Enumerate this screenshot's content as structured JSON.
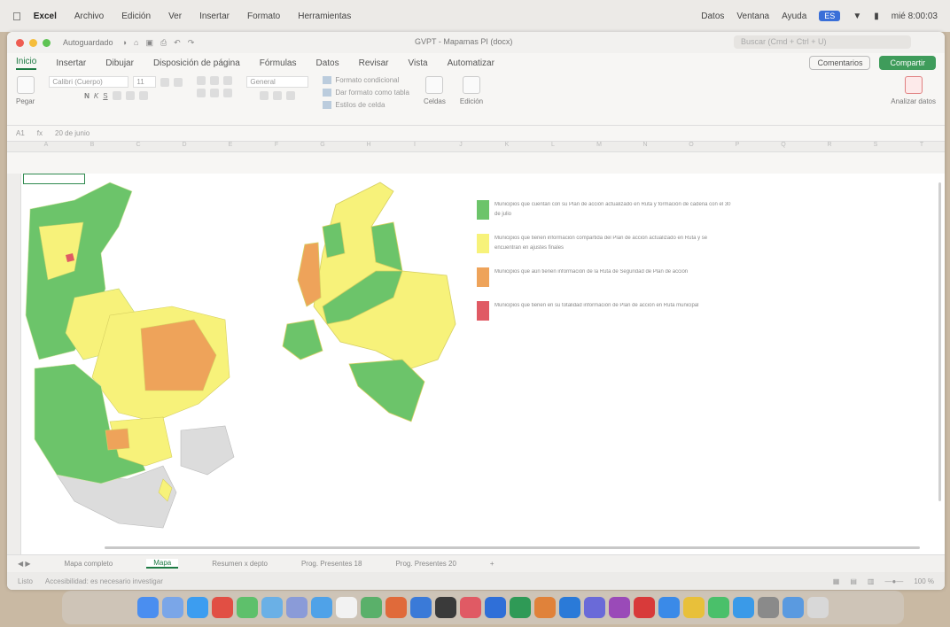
{
  "menubar": {
    "app": "Excel",
    "items": [
      "Archivo",
      "Edición",
      "Ver",
      "Insertar",
      "Formato",
      "Herramientas"
    ],
    "right_items": [
      "Datos",
      "Ventana",
      "Ayuda"
    ],
    "clock": "mié 8:00:03"
  },
  "window": {
    "autosave": "Autoguardado",
    "title": "GVPT - Mapamas PI (docx)",
    "search_placeholder": "Buscar (Cmd + Ctrl + U)"
  },
  "ribbon_tabs": {
    "tabs": [
      "Inicio",
      "Insertar",
      "Dibujar",
      "Disposición de página",
      "Fórmulas",
      "Datos",
      "Revisar",
      "Vista",
      "Automatizar"
    ],
    "comments": "Comentarios",
    "share": "Compartir"
  },
  "ribbon": {
    "paste": "Pegar",
    "font": "Calibri (Cuerpo)",
    "size": "11",
    "number_format": "General",
    "conditional": "Formato condicional",
    "as_table": "Dar formato como tabla",
    "cell_styles": "Estilos de celda",
    "cells": "Celdas",
    "editing": "Edición",
    "analyze": "Analizar datos"
  },
  "formula_bar": {
    "cell_ref": "A1",
    "fx": "fx",
    "content": "20 de junio"
  },
  "column_letters": [
    "A",
    "B",
    "C",
    "D",
    "E",
    "F",
    "G",
    "H",
    "I",
    "J",
    "K",
    "L",
    "M",
    "N",
    "O",
    "P",
    "Q",
    "R",
    "S",
    "T"
  ],
  "legend": {
    "items": [
      {
        "color": "#6cc46a",
        "text": "Municipios que cuentan con su Plan de acción actualizado en Ruta y formación de cadena con el 30 de julio"
      },
      {
        "color": "#f7f27a",
        "text": "Municipios que tienen información compartida del Plan de acción actualizado en Ruta y se encuentran en ajustes finales"
      },
      {
        "color": "#eea35a",
        "text": "Municipios que aún tienen información de la Ruta de Seguridad de Plan de acción"
      },
      {
        "color": "#e05a64",
        "text": "Municipios que tienen en su totalidad información de Plan de acción en Ruta municipal"
      }
    ]
  },
  "sheet_tabs": {
    "tabs": [
      "Mapa completo",
      "Mapa",
      "Resumen x depto",
      "Prog. Presentes 18",
      "Prog. Presentes 20"
    ],
    "active_index": 1
  },
  "status_bar": {
    "ready": "Listo",
    "accessibility": "Accesibilidad: es necesario investigar",
    "zoom": "100 %"
  },
  "colors": {
    "green": "#6cc46a",
    "yellow": "#f7f27a",
    "orange": "#eea35a",
    "red": "#e05a64",
    "gray": "#dcdcdc",
    "accent": "#1d7a43"
  }
}
